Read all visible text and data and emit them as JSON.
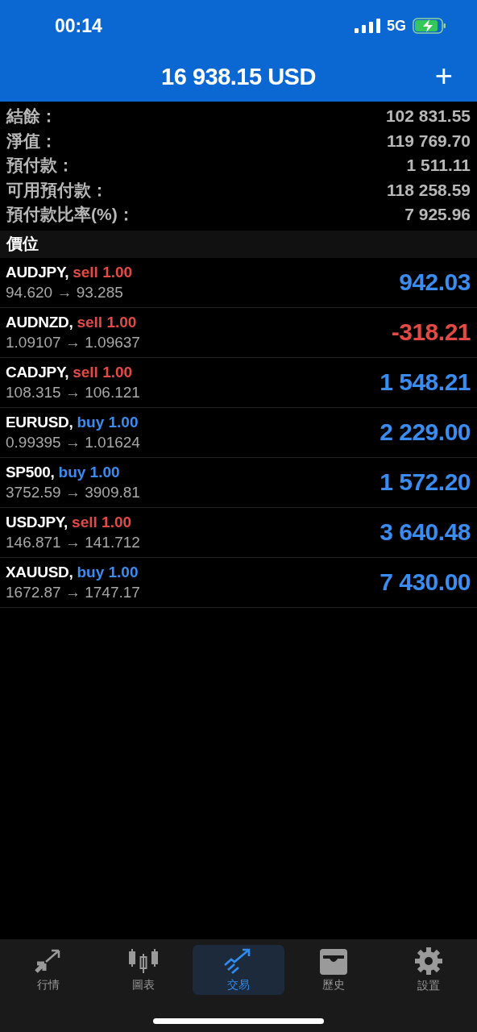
{
  "status_bar": {
    "time": "00:14",
    "network": "5G"
  },
  "header": {
    "title": "16 938.15 USD",
    "add": "+"
  },
  "summary": [
    {
      "label": "結餘：",
      "value": "102 831.55"
    },
    {
      "label": "淨值：",
      "value": "119 769.70"
    },
    {
      "label": "預付款：",
      "value": "1 511.11"
    },
    {
      "label": "可用預付款：",
      "value": "118 258.59"
    },
    {
      "label": "預付款比率(%)：",
      "value": "7 925.96"
    }
  ],
  "section": "價位",
  "positions": [
    {
      "symbol": "AUDJPY,",
      "trade": {
        "text": "sell 1.00",
        "color": "#e34a45"
      },
      "prices": "94.620 → 93.285",
      "profit": {
        "text": "942.03",
        "color": "#3a8cf0"
      }
    },
    {
      "symbol": "AUDNZD,",
      "trade": {
        "text": "sell 1.00",
        "color": "#e34a45"
      },
      "prices": "1.09107 → 1.09637",
      "profit": {
        "text": "-318.21",
        "color": "#e34a45"
      }
    },
    {
      "symbol": "CADJPY,",
      "trade": {
        "text": "sell 1.00",
        "color": "#e34a45"
      },
      "prices": "108.315 → 106.121",
      "profit": {
        "text": "1 548.21",
        "color": "#3a8cf0"
      }
    },
    {
      "symbol": "EURUSD,",
      "trade": {
        "text": "buy 1.00",
        "color": "#3a8cf0"
      },
      "prices": "0.99395 → 1.01624",
      "profit": {
        "text": "2 229.00",
        "color": "#3a8cf0"
      }
    },
    {
      "symbol": "SP500,",
      "trade": {
        "text": "buy 1.00",
        "color": "#3a8cf0"
      },
      "prices": "3752.59 → 3909.81",
      "profit": {
        "text": "1 572.20",
        "color": "#3a8cf0"
      }
    },
    {
      "symbol": "USDJPY,",
      "trade": {
        "text": "sell 1.00",
        "color": "#e34a45"
      },
      "prices": "146.871 → 141.712",
      "profit": {
        "text": "3 640.48",
        "color": "#3a8cf0"
      }
    },
    {
      "symbol": "XAUUSD,",
      "trade": {
        "text": "buy 1.00",
        "color": "#3a8cf0"
      },
      "prices": "1672.87 → 1747.17",
      "profit": {
        "text": "7 430.00",
        "color": "#3a8cf0"
      }
    }
  ],
  "tabs": [
    {
      "label": "行情",
      "selected": false
    },
    {
      "label": "圖表",
      "selected": false
    },
    {
      "label": "交易",
      "selected": true
    },
    {
      "label": "歷史",
      "selected": false
    },
    {
      "label": "設置",
      "selected": false
    }
  ]
}
